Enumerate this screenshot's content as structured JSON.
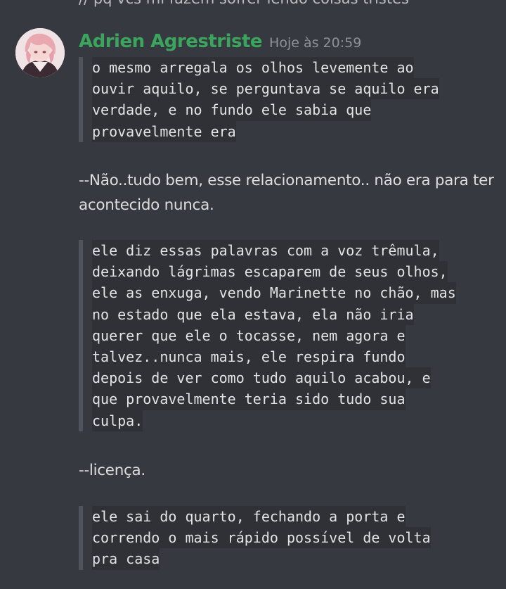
{
  "previous_message": {
    "text": "// pq vcs mi fazem sofrer lendo coisas tristes"
  },
  "message": {
    "username": "Adrien Agrestriste",
    "timestamp": "Hoje às 20:59",
    "avatar_icon": "anime-avatar-icon",
    "username_color": "#3ba55d",
    "quote1": [
      "o mesmo arregala os olhos levemente ao",
      "ouvir aquilo, se perguntava se aquilo era",
      "verdade, e no fundo ele sabia que",
      "provavelmente era"
    ],
    "line1": "--Não..tudo bem, esse relacionamento.. não era para ter acontecido nunca.",
    "quote2": [
      "ele diz essas palavras com a voz trêmula,",
      "deixando lágrimas escaparem de seus olhos,",
      "ele as enxuga, vendo Marinette no chão, mas",
      "no estado que ela estava, ela não iria",
      "querer que ele o tocasse, nem agora e",
      "talvez..nunca mais, ele respira fundo",
      "depois de ver como tudo aquilo acabou, e",
      "que provavelmente teria sido tudo sua",
      "culpa."
    ],
    "line2": "--licença.",
    "quote3": [
      "ele sai do quarto, fechando a porta e",
      "correndo o mais rápido possível de volta",
      "pra casa"
    ]
  }
}
